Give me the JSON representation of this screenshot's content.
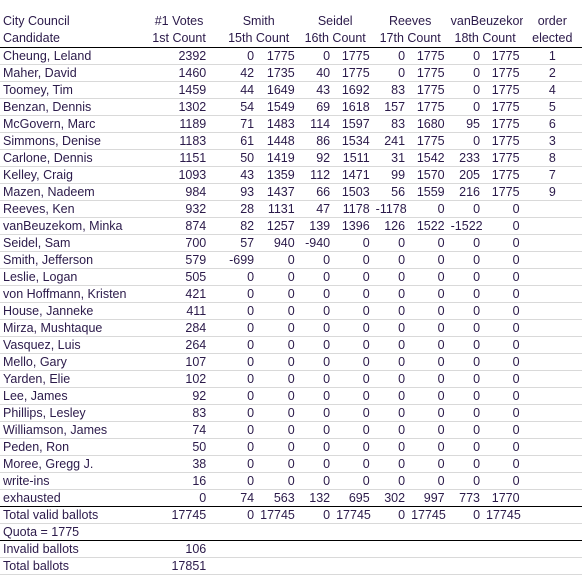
{
  "sheet": {
    "title_row": {
      "title": "City Council",
      "first_votes": "#1 Votes",
      "round_owners": [
        "Smith",
        "Seidel",
        "Reeves",
        "vanBeuzekom"
      ],
      "order": "order"
    },
    "subheader_row": {
      "candidate": "Candidate",
      "first_count": "1st Count",
      "counts": [
        "15th Count",
        "16th Count",
        "17th Count",
        "18th Count"
      ],
      "elected": "elected"
    }
  },
  "rows": [
    {
      "name": "Cheung, Leland",
      "first": "2392",
      "c15": [
        "0",
        "1775"
      ],
      "c16": [
        "0",
        "1775"
      ],
      "c17": [
        "0",
        "1775"
      ],
      "c18": [
        "0",
        "1775"
      ],
      "order": "1",
      "bold17": false
    },
    {
      "name": "Maher, David",
      "first": "1460",
      "c15": [
        "42",
        "1735"
      ],
      "c16": [
        "40",
        "1775"
      ],
      "c17": [
        "0",
        "1775"
      ],
      "c18": [
        "0",
        "1775"
      ],
      "order": "2",
      "bold17": false
    },
    {
      "name": "Toomey, Tim",
      "first": "1459",
      "c15": [
        "44",
        "1649"
      ],
      "c16": [
        "43",
        "1692"
      ],
      "c17": [
        "83",
        "1775"
      ],
      "c18": [
        "0",
        "1775"
      ],
      "order": "4",
      "bold17": false
    },
    {
      "name": "Benzan, Dennis",
      "first": "1302",
      "c15": [
        "54",
        "1549"
      ],
      "c16": [
        "69",
        "1618"
      ],
      "c17": [
        "157",
        "1775"
      ],
      "c18": [
        "0",
        "1775"
      ],
      "order": "5",
      "bold17": false
    },
    {
      "name": "McGovern, Marc",
      "first": "1189",
      "c15": [
        "71",
        "1483"
      ],
      "c16": [
        "114",
        "1597"
      ],
      "c17": [
        "83",
        "1680"
      ],
      "c18": [
        "95",
        "1775"
      ],
      "order": "6",
      "bold17": false
    },
    {
      "name": "Simmons, Denise",
      "first": "1183",
      "c15": [
        "61",
        "1448"
      ],
      "c16": [
        "86",
        "1534"
      ],
      "c17": [
        "241",
        "1775"
      ],
      "c18": [
        "0",
        "1775"
      ],
      "order": "3",
      "bold17": false
    },
    {
      "name": "Carlone, Dennis",
      "first": "1151",
      "c15": [
        "50",
        "1419"
      ],
      "c16": [
        "92",
        "1511"
      ],
      "c17": [
        "31",
        "1542"
      ],
      "c18": [
        "233",
        "1775"
      ],
      "order": "8",
      "bold17": true
    },
    {
      "name": "Kelley, Craig",
      "first": "1093",
      "c15": [
        "43",
        "1359"
      ],
      "c16": [
        "112",
        "1471"
      ],
      "c17": [
        "99",
        "1570"
      ],
      "c18": [
        "205",
        "1775"
      ],
      "order": "7",
      "bold17": true
    },
    {
      "name": "Mazen, Nadeem",
      "first": "984",
      "c15": [
        "93",
        "1437"
      ],
      "c16": [
        "66",
        "1503"
      ],
      "c17": [
        "56",
        "1559"
      ],
      "c18": [
        "216",
        "1775"
      ],
      "order": "9",
      "bold17": true
    },
    {
      "name": "Reeves, Ken",
      "first": "932",
      "c15": [
        "28",
        "1131"
      ],
      "c16": [
        "47",
        "1178"
      ],
      "c17": [
        "-1178",
        "0"
      ],
      "c18": [
        "0",
        "0"
      ],
      "order": "",
      "bold17": false
    },
    {
      "name": "vanBeuzekom, Minka",
      "first": "874",
      "c15": [
        "82",
        "1257"
      ],
      "c16": [
        "139",
        "1396"
      ],
      "c17": [
        "126",
        "1522"
      ],
      "c18": [
        "-1522",
        "0"
      ],
      "order": "",
      "bold17": true
    },
    {
      "name": "Seidel, Sam",
      "first": "700",
      "c15": [
        "57",
        "940"
      ],
      "c16": [
        "-940",
        "0"
      ],
      "c17": [
        "0",
        "0"
      ],
      "c18": [
        "0",
        "0"
      ],
      "order": "",
      "bold17": false
    },
    {
      "name": "Smith, Jefferson",
      "first": "579",
      "c15": [
        "-699",
        "0"
      ],
      "c16": [
        "0",
        "0"
      ],
      "c17": [
        "0",
        "0"
      ],
      "c18": [
        "0",
        "0"
      ],
      "order": "",
      "bold17": false
    },
    {
      "name": "Leslie, Logan",
      "first": "505",
      "c15": [
        "0",
        "0"
      ],
      "c16": [
        "0",
        "0"
      ],
      "c17": [
        "0",
        "0"
      ],
      "c18": [
        "0",
        "0"
      ],
      "order": "",
      "bold17": false
    },
    {
      "name": "von Hoffmann, Kristen",
      "first": "421",
      "c15": [
        "0",
        "0"
      ],
      "c16": [
        "0",
        "0"
      ],
      "c17": [
        "0",
        "0"
      ],
      "c18": [
        "0",
        "0"
      ],
      "order": "",
      "bold17": false
    },
    {
      "name": "House, Janneke",
      "first": "411",
      "c15": [
        "0",
        "0"
      ],
      "c16": [
        "0",
        "0"
      ],
      "c17": [
        "0",
        "0"
      ],
      "c18": [
        "0",
        "0"
      ],
      "order": "",
      "bold17": false
    },
    {
      "name": "Mirza, Mushtaque",
      "first": "284",
      "c15": [
        "0",
        "0"
      ],
      "c16": [
        "0",
        "0"
      ],
      "c17": [
        "0",
        "0"
      ],
      "c18": [
        "0",
        "0"
      ],
      "order": "",
      "bold17": false
    },
    {
      "name": "Vasquez, Luis",
      "first": "264",
      "c15": [
        "0",
        "0"
      ],
      "c16": [
        "0",
        "0"
      ],
      "c17": [
        "0",
        "0"
      ],
      "c18": [
        "0",
        "0"
      ],
      "order": "",
      "bold17": false
    },
    {
      "name": "Mello, Gary",
      "first": "107",
      "c15": [
        "0",
        "0"
      ],
      "c16": [
        "0",
        "0"
      ],
      "c17": [
        "0",
        "0"
      ],
      "c18": [
        "0",
        "0"
      ],
      "order": "",
      "bold17": false
    },
    {
      "name": "Yarden, Elie",
      "first": "102",
      "c15": [
        "0",
        "0"
      ],
      "c16": [
        "0",
        "0"
      ],
      "c17": [
        "0",
        "0"
      ],
      "c18": [
        "0",
        "0"
      ],
      "order": "",
      "bold17": false
    },
    {
      "name": "Lee, James",
      "first": "92",
      "c15": [
        "0",
        "0"
      ],
      "c16": [
        "0",
        "0"
      ],
      "c17": [
        "0",
        "0"
      ],
      "c18": [
        "0",
        "0"
      ],
      "order": "",
      "bold17": false
    },
    {
      "name": "Phillips, Lesley",
      "first": "83",
      "c15": [
        "0",
        "0"
      ],
      "c16": [
        "0",
        "0"
      ],
      "c17": [
        "0",
        "0"
      ],
      "c18": [
        "0",
        "0"
      ],
      "order": "",
      "bold17": false
    },
    {
      "name": "Williamson, James",
      "first": "74",
      "c15": [
        "0",
        "0"
      ],
      "c16": [
        "0",
        "0"
      ],
      "c17": [
        "0",
        "0"
      ],
      "c18": [
        "0",
        "0"
      ],
      "order": "",
      "bold17": false
    },
    {
      "name": "Peden, Ron",
      "first": "50",
      "c15": [
        "0",
        "0"
      ],
      "c16": [
        "0",
        "0"
      ],
      "c17": [
        "0",
        "0"
      ],
      "c18": [
        "0",
        "0"
      ],
      "order": "",
      "bold17": false
    },
    {
      "name": "Moree, Gregg J.",
      "first": "38",
      "c15": [
        "0",
        "0"
      ],
      "c16": [
        "0",
        "0"
      ],
      "c17": [
        "0",
        "0"
      ],
      "c18": [
        "0",
        "0"
      ],
      "order": "",
      "bold17": false
    },
    {
      "name": "write-ins",
      "first": "16",
      "c15": [
        "0",
        "0"
      ],
      "c16": [
        "0",
        "0"
      ],
      "c17": [
        "0",
        "0"
      ],
      "c18": [
        "0",
        "0"
      ],
      "order": "",
      "bold17": false
    },
    {
      "name": "exhausted",
      "first": "0",
      "c15": [
        "74",
        "563"
      ],
      "c16": [
        "132",
        "695"
      ],
      "c17": [
        "302",
        "997"
      ],
      "c18": [
        "773",
        "1770"
      ],
      "order": "",
      "bold17": false
    }
  ],
  "footer": {
    "total_valid": {
      "label": "Total valid ballots",
      "first": "17745",
      "c15": [
        "0",
        "17745"
      ],
      "c16": [
        "0",
        "17745"
      ],
      "c17": [
        "0",
        "17745"
      ],
      "c18": [
        "0",
        "17745"
      ]
    },
    "quota": {
      "label": "Quota = 1775",
      "first": "",
      "c15": [
        "",
        ""
      ],
      "c16": [
        "",
        ""
      ],
      "c17": [
        "",
        ""
      ],
      "c18": [
        "",
        ""
      ]
    },
    "invalid": {
      "label": "Invalid ballots",
      "first": "106"
    },
    "total": {
      "label": "Total ballots",
      "first": "17851"
    }
  }
}
